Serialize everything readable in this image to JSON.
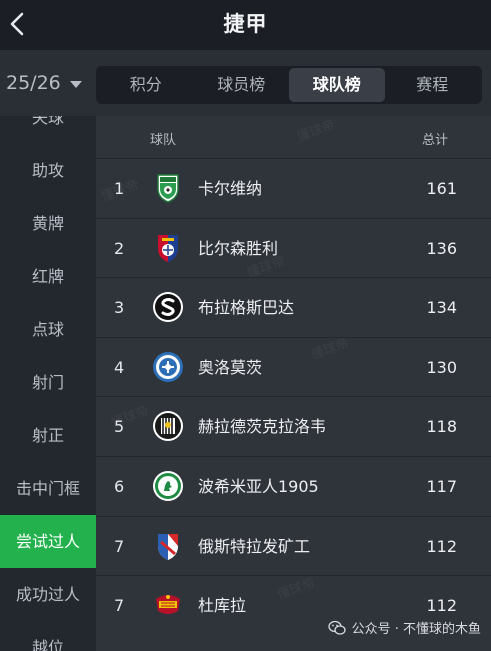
{
  "header": {
    "title": "捷甲"
  },
  "season": {
    "label": "25/26"
  },
  "tabs": [
    {
      "label": "积分",
      "active": false
    },
    {
      "label": "球员榜",
      "active": false
    },
    {
      "label": "球队榜",
      "active": true
    },
    {
      "label": "赛程",
      "active": false
    }
  ],
  "sidebar": {
    "items": [
      {
        "label": "失球"
      },
      {
        "label": "助攻"
      },
      {
        "label": "黄牌"
      },
      {
        "label": "红牌"
      },
      {
        "label": "点球"
      },
      {
        "label": "射门"
      },
      {
        "label": "射正"
      },
      {
        "label": "击中门框"
      },
      {
        "label": "尝试过人",
        "active": true
      },
      {
        "label": "成功过人"
      },
      {
        "label": "越位"
      }
    ]
  },
  "table": {
    "columns": {
      "team": "球队",
      "total": "总计"
    },
    "rows": [
      {
        "rank": "1",
        "team": "卡尔维纳",
        "total": "161",
        "logo": "karvina-crest-icon"
      },
      {
        "rank": "2",
        "team": "比尔森胜利",
        "total": "136",
        "logo": "plzen-crest-icon"
      },
      {
        "rank": "3",
        "team": "布拉格斯巴达",
        "total": "134",
        "logo": "sparta-crest-icon"
      },
      {
        "rank": "4",
        "team": "奥洛莫茨",
        "total": "130",
        "logo": "olomouc-crest-icon"
      },
      {
        "rank": "5",
        "team": "赫拉德茨克拉洛韦",
        "total": "118",
        "logo": "hradec-crest-icon"
      },
      {
        "rank": "6",
        "team": "波希米亚人1905",
        "total": "117",
        "logo": "bohemians-crest-icon"
      },
      {
        "rank": "7",
        "team": "俄斯特拉发矿工",
        "total": "112",
        "logo": "ostrava-crest-icon"
      },
      {
        "rank": "7",
        "team": "杜库拉",
        "total": "112",
        "logo": "dukla-crest-icon"
      }
    ]
  },
  "watermark": {
    "text": "懂球帝"
  },
  "footer": {
    "text": "公众号 · 不懂球的木鱼"
  },
  "colors": {
    "accent": "#22b14c",
    "background": "#1b1e24",
    "panel": "#2f333a"
  }
}
